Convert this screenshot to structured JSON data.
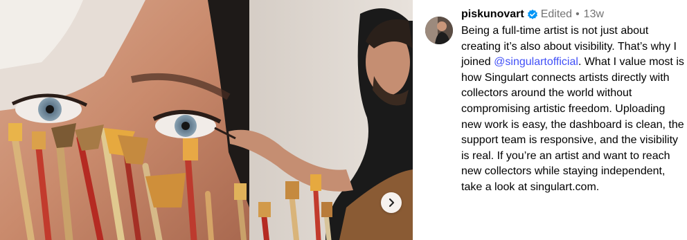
{
  "post": {
    "username": "piskunovart",
    "edited_label": "Edited",
    "separator": "•",
    "timestamp": "13w",
    "caption_part1": "Being a full-time artist is not just about creating it’s also about visibility. That’s why I joined ",
    "mention": "@singulartofficial",
    "caption_part2": ". What I value most is how Singulart connects artists directly with collectors around the world without compromising artistic freedom. Uploading new work is easy, the dashboard is clean, the support team is responsive, and the visibility is real. If you’re an artist and want to reach new collectors while staying independent, take a look at singulart.com."
  },
  "media": {
    "next_icon": "chevron-right-icon"
  },
  "colors": {
    "mention": "#4150f7",
    "muted": "#737373",
    "verified": "#0095f6"
  }
}
